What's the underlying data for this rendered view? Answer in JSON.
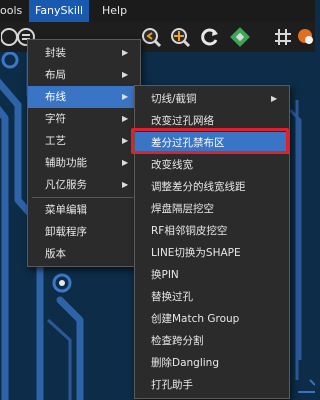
{
  "menubar": {
    "items": [
      {
        "label": "ools"
      },
      {
        "label": "FanySkill"
      },
      {
        "label": "Help"
      }
    ]
  },
  "fanyskill_menu": {
    "items": [
      {
        "label": "封装",
        "submenu": true
      },
      {
        "label": "布局",
        "submenu": true
      },
      {
        "label": "布线",
        "submenu": true,
        "highlighted": true
      },
      {
        "label": "字符",
        "submenu": true
      },
      {
        "label": "工艺",
        "submenu": true
      },
      {
        "label": "辅助功能",
        "submenu": true
      },
      {
        "label": "凡亿服务",
        "submenu": true
      },
      {
        "label": "菜单编辑",
        "submenu": false
      },
      {
        "label": "卸载程序",
        "submenu": false
      },
      {
        "label": "版本",
        "submenu": false
      }
    ]
  },
  "routing_submenu": {
    "items": [
      {
        "label": "切线/截铜",
        "submenu": true
      },
      {
        "label": "改变过孔网络"
      },
      {
        "label": "差分过孔禁布区",
        "highlighted": true
      },
      {
        "label": "改变线宽"
      },
      {
        "label": "调整差分的线宽线距"
      },
      {
        "label": "焊盘隔层挖空"
      },
      {
        "label": "RF相邻铜皮挖空"
      },
      {
        "label": "LINE切换为SHAPE"
      },
      {
        "label": "换PIN"
      },
      {
        "label": "替换过孔"
      },
      {
        "label": "创建Match Group"
      },
      {
        "label": "检查跨分割"
      },
      {
        "label": "删除Dangling"
      },
      {
        "label": "打孔助手"
      }
    ]
  },
  "colors": {
    "menubar_active": "#1a59b0",
    "menu_highlight": "#3a74c4",
    "callout_border": "#e0212c",
    "pcb_background": "#0c2c47",
    "trace": "#2f63a8"
  }
}
